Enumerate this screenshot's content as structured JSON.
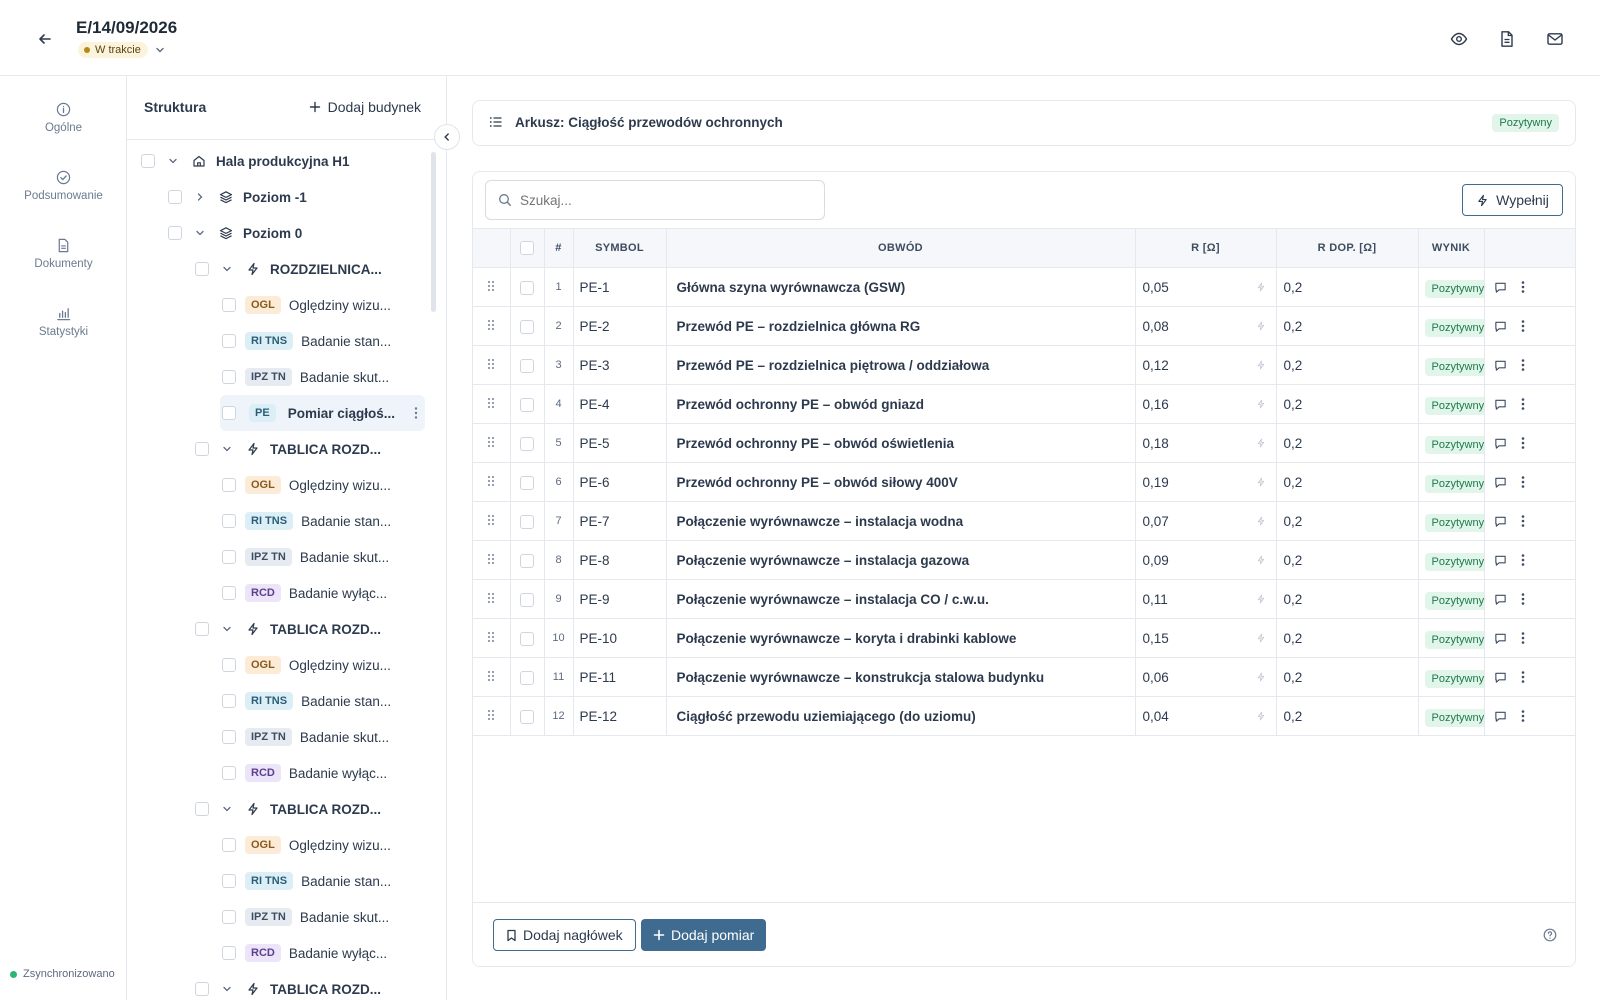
{
  "header": {
    "title": "E/14/09/2026",
    "status": "W trakcie"
  },
  "nav": {
    "items": [
      {
        "label": "Ogólne",
        "icon": "info-icon"
      },
      {
        "label": "Podsumowanie",
        "icon": "check-circle-icon"
      },
      {
        "label": "Dokumenty",
        "icon": "document-icon"
      },
      {
        "label": "Statystyki",
        "icon": "chart-icon"
      }
    ],
    "sync_label": "Zsynchronizowano"
  },
  "tree": {
    "title": "Struktura",
    "add_building": "Dodaj budynek",
    "rows": [
      {
        "label": "Hala produkcyjna H1"
      },
      {
        "label": "Poziom -1"
      },
      {
        "label": "Poziom 0"
      },
      {
        "label": "ROZDZIELNICA..."
      },
      {
        "tag": "OGL",
        "label": "Oględziny wizu..."
      },
      {
        "tag": "RI TNS",
        "label": "Badanie stan..."
      },
      {
        "tag": "IPZ TN",
        "label": "Badanie skut..."
      },
      {
        "tag": "PE",
        "label": "Pomiar ciągłoś..."
      },
      {
        "label": "TABLICA ROZD..."
      },
      {
        "tag": "OGL",
        "label": "Oględziny wizu..."
      },
      {
        "tag": "RI TNS",
        "label": "Badanie stan..."
      },
      {
        "tag": "IPZ TN",
        "label": "Badanie skut..."
      },
      {
        "tag": "RCD",
        "label": "Badanie wyłąc..."
      },
      {
        "label": "TABLICA ROZD..."
      },
      {
        "tag": "OGL",
        "label": "Oględziny wizu..."
      },
      {
        "tag": "RI TNS",
        "label": "Badanie stan..."
      },
      {
        "tag": "IPZ TN",
        "label": "Badanie skut..."
      },
      {
        "tag": "RCD",
        "label": "Badanie wyłąc..."
      },
      {
        "label": "TABLICA ROZD..."
      },
      {
        "tag": "OGL",
        "label": "Oględziny wizu..."
      },
      {
        "tag": "RI TNS",
        "label": "Badanie stan..."
      },
      {
        "tag": "IPZ TN",
        "label": "Badanie skut..."
      },
      {
        "tag": "RCD",
        "label": "Badanie wyłąc..."
      },
      {
        "label": "TABLICA ROZD..."
      }
    ]
  },
  "sheet": {
    "title": "Arkusz: Ciągłość przewodów ochronnych",
    "result_badge": "Pozytywny"
  },
  "toolbar": {
    "search_placeholder": "Szukaj...",
    "fill_label": "Wypełnij"
  },
  "table": {
    "headers": {
      "num": "#",
      "symbol": "SYMBOL",
      "obwod": "OBWÓD",
      "r": "R [Ω]",
      "rdop": "R DOP. [Ω]",
      "wynik": "WYNIK"
    },
    "rows": [
      {
        "num": "1",
        "symbol": "PE-1",
        "obwod": "Główna szyna wyrównawcza (GSW)",
        "r": "0,05",
        "rdop": "0,2",
        "wynik": "Pozytywny"
      },
      {
        "num": "2",
        "symbol": "PE-2",
        "obwod": "Przewód PE – rozdzielnica główna RG",
        "r": "0,08",
        "rdop": "0,2",
        "wynik": "Pozytywny"
      },
      {
        "num": "3",
        "symbol": "PE-3",
        "obwod": "Przewód PE – rozdzielnica piętrowa / oddziałowa",
        "r": "0,12",
        "rdop": "0,2",
        "wynik": "Pozytywny"
      },
      {
        "num": "4",
        "symbol": "PE-4",
        "obwod": "Przewód ochronny PE – obwód gniazd",
        "r": "0,16",
        "rdop": "0,2",
        "wynik": "Pozytywny"
      },
      {
        "num": "5",
        "symbol": "PE-5",
        "obwod": "Przewód ochronny PE – obwód oświetlenia",
        "r": "0,18",
        "rdop": "0,2",
        "wynik": "Pozytywny"
      },
      {
        "num": "6",
        "symbol": "PE-6",
        "obwod": "Przewód ochronny PE – obwód siłowy 400V",
        "r": "0,19",
        "rdop": "0,2",
        "wynik": "Pozytywny"
      },
      {
        "num": "7",
        "symbol": "PE-7",
        "obwod": "Połączenie wyrównawcze – instalacja wodna",
        "r": "0,07",
        "rdop": "0,2",
        "wynik": "Pozytywny"
      },
      {
        "num": "8",
        "symbol": "PE-8",
        "obwod": "Połączenie wyrównawcze – instalacja gazowa",
        "r": "0,09",
        "rdop": "0,2",
        "wynik": "Pozytywny"
      },
      {
        "num": "9",
        "symbol": "PE-9",
        "obwod": "Połączenie wyrównawcze – instalacja CO / c.w.u.",
        "r": "0,11",
        "rdop": "0,2",
        "wynik": "Pozytywny"
      },
      {
        "num": "10",
        "symbol": "PE-10",
        "obwod": "Połączenie wyrównawcze – koryta i drabinki kablowe",
        "r": "0,15",
        "rdop": "0,2",
        "wynik": "Pozytywny"
      },
      {
        "num": "11",
        "symbol": "PE-11",
        "obwod": "Połączenie wyrównawcze – konstrukcja stalowa budynku",
        "r": "0,06",
        "rdop": "0,2",
        "wynik": "Pozytywny"
      },
      {
        "num": "12",
        "symbol": "PE-12",
        "obwod": "Ciągłość przewodu uziemiającego (do uziomu)",
        "r": "0,04",
        "rdop": "0,2",
        "wynik": "Pozytywny"
      }
    ]
  },
  "footer": {
    "add_header_label": "Dodaj nagłówek",
    "add_measurement_label": "Dodaj pomiar"
  },
  "colors": {
    "accent": "#3e6b8f",
    "positive_bg": "#e1f5ea",
    "positive_text": "#1d7a4a",
    "status_bg": "#fbf3dc"
  }
}
